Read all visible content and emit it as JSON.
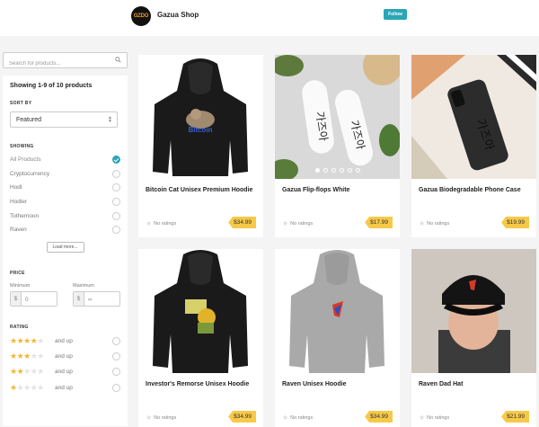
{
  "shop": {
    "logo_text": "GZDO",
    "name": "Gazua Shop",
    "follow_label": "Follow"
  },
  "search": {
    "placeholder": "Search for products..."
  },
  "results": {
    "count_text": "Showing 1-9 of 10 products"
  },
  "sort": {
    "heading": "SORT BY",
    "selected": "Featured"
  },
  "showing": {
    "heading": "SHOWING",
    "options": [
      {
        "label": "All Products",
        "selected": true
      },
      {
        "label": "Cryptocurrency",
        "selected": false
      },
      {
        "label": "Hodl",
        "selected": false
      },
      {
        "label": "Hodler",
        "selected": false
      },
      {
        "label": "Tothemoon",
        "selected": false
      },
      {
        "label": "Raven",
        "selected": false
      }
    ],
    "load_more": "Load more..."
  },
  "price": {
    "heading": "PRICE",
    "min_label": "Minimum",
    "max_label": "Maximum",
    "currency": "$",
    "min_value": "0",
    "max_value": "∞"
  },
  "rating": {
    "heading": "RATING",
    "and_up": "and up",
    "levels": [
      {
        "stars": 4
      },
      {
        "stars": 3
      },
      {
        "stars": 2
      },
      {
        "stars": 1
      }
    ]
  },
  "products": [
    {
      "title": "Bitcoin Cat Unisex Premium Hoodie",
      "rating_text": "No ratings",
      "price": "$34.99",
      "image": "black-hoodie-bitcoin-cat"
    },
    {
      "title": "Gazua Flip-flops White",
      "rating_text": "No ratings",
      "price": "$17.99",
      "image": "white-flip-flops"
    },
    {
      "title": "Gazua Biodegradable Phone Case",
      "rating_text": "No ratings",
      "price": "$19.99",
      "image": "black-phone-case"
    },
    {
      "title": "Investor's Remorse Unisex Hoodie",
      "rating_text": "No ratings",
      "price": "$34.99",
      "image": "black-hoodie-remorse"
    },
    {
      "title": "Raven Unisex Hoodie",
      "rating_text": "No ratings",
      "price": "$34.99",
      "image": "grey-hoodie-raven"
    },
    {
      "title": "Raven Dad Hat",
      "rating_text": "No ratings",
      "price": "$21.99",
      "image": "black-dad-hat"
    }
  ],
  "image_text": {
    "bitcoin": "Bitcoin",
    "flipflop_glyph": "가즈아",
    "case_glyph": "가즈아"
  },
  "colors": {
    "accent": "#2aa6b6",
    "price_tag": "#f7c948",
    "star": "#f2b632"
  }
}
